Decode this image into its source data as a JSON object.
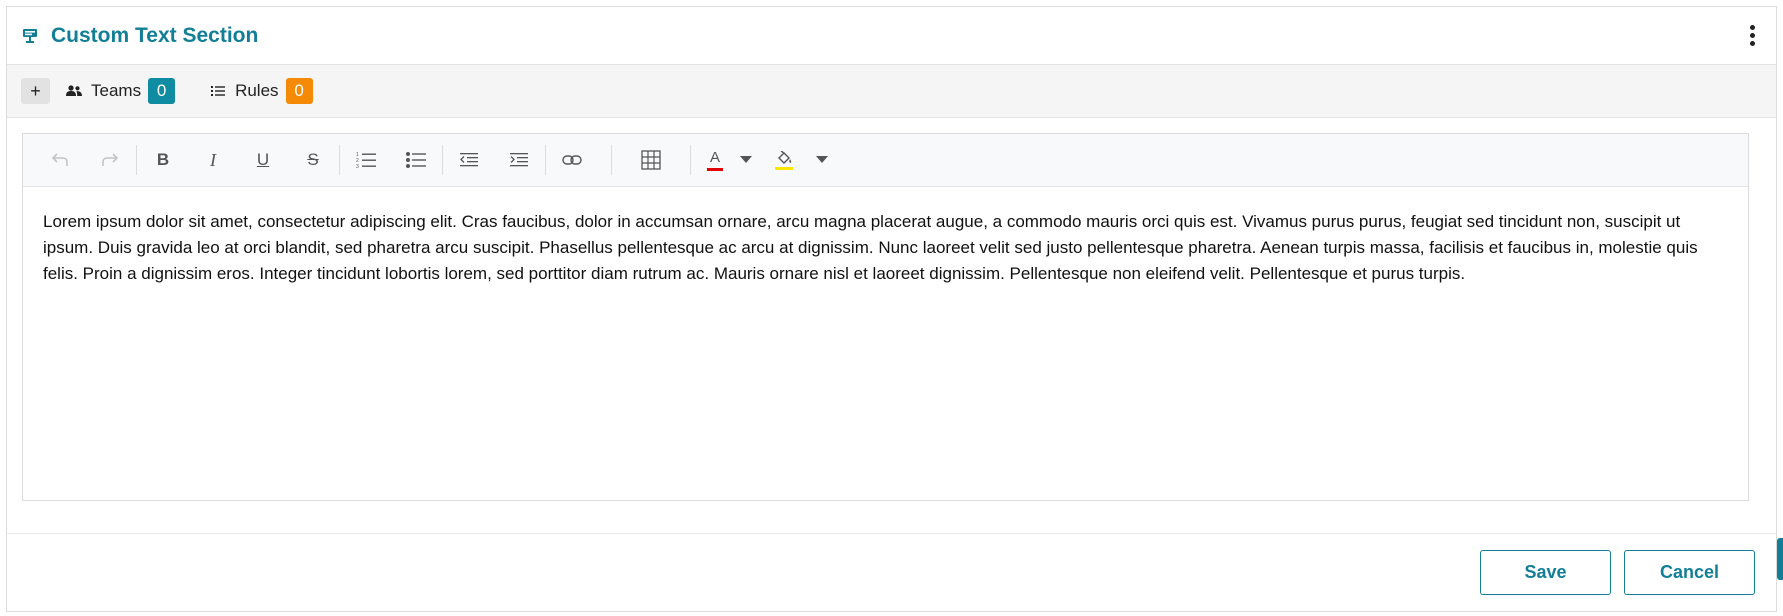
{
  "header": {
    "title": "Custom Text Section",
    "icon": "presentation-icon",
    "menu_icon": "kebab-menu-icon"
  },
  "tabbar": {
    "add_label": "+",
    "tabs": [
      {
        "label": "Teams",
        "count": "0",
        "icon": "people-icon",
        "badge_color": "#0f8ba2"
      },
      {
        "label": "Rules",
        "count": "0",
        "icon": "list-icon",
        "badge_color": "#f58a07"
      }
    ]
  },
  "toolbar": {
    "tools": [
      "undo",
      "redo",
      "bold",
      "italic",
      "underline",
      "strikethrough",
      "ordered-list",
      "bullet-list",
      "outdent",
      "indent",
      "link",
      "table",
      "text-color",
      "highlight-color"
    ],
    "bold_glyph": "B",
    "italic_glyph": "I",
    "underline_glyph": "U",
    "strike_glyph": "S",
    "text_color_glyph": "A",
    "text_color_swatch": "#e00000",
    "highlight_swatch": "#ffe600"
  },
  "editor": {
    "content": "Lorem ipsum dolor sit amet, consectetur adipiscing elit. Cras faucibus, dolor in accumsan ornare, arcu magna placerat augue, a commodo mauris orci quis est. Vivamus purus purus, feugiat sed tincidunt non, suscipit ut ipsum. Duis gravida leo at orci blandit, sed pharetra arcu suscipit. Phasellus pellentesque ac arcu at dignissim. Nunc laoreet velit sed justo pellentesque pharetra. Aenean turpis massa, facilisis et faucibus in, molestie quis felis. Proin a dignissim eros. Integer tincidunt lobortis lorem, sed porttitor diam rutrum ac. Mauris ornare nisl et laoreet dignissim. Pellentesque non eleifend velit. Pellentesque et purus turpis."
  },
  "footer": {
    "save_label": "Save",
    "cancel_label": "Cancel"
  },
  "colors": {
    "accent": "#137f97",
    "teal_badge": "#0f8ba2",
    "orange_badge": "#f58a07"
  }
}
